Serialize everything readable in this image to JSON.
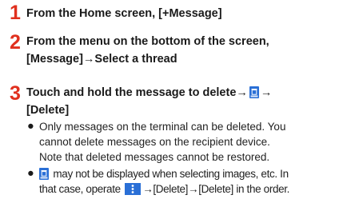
{
  "steps": [
    {
      "number": "1",
      "text": "From the Home screen, [+Message]"
    },
    {
      "number": "2",
      "line1": "From the menu on the bottom of the screen,",
      "line2": "[Message]→Select a thread"
    },
    {
      "number": "3",
      "line1_a": "Touch and hold the message to delete→",
      "line1_b": "→",
      "line2": "[Delete]"
    }
  ],
  "notes": [
    {
      "lines": [
        "Only messages on the terminal can be deleted. You",
        "cannot delete messages on the recipient device.",
        "Note that deleted messages cannot be restored."
      ]
    },
    {
      "line1": "may not be displayed when selecting images, etc. In",
      "line2_a": "that case, operate",
      "line2_b": "→[Delete]→[Delete] in the order."
    }
  ],
  "bullet_glyph": "●",
  "icons": {
    "trash": "trash-icon",
    "menu": "more-menu-icon"
  },
  "colors": {
    "step_number": "#e0301e",
    "icon_blue": "#2a6fd6"
  }
}
